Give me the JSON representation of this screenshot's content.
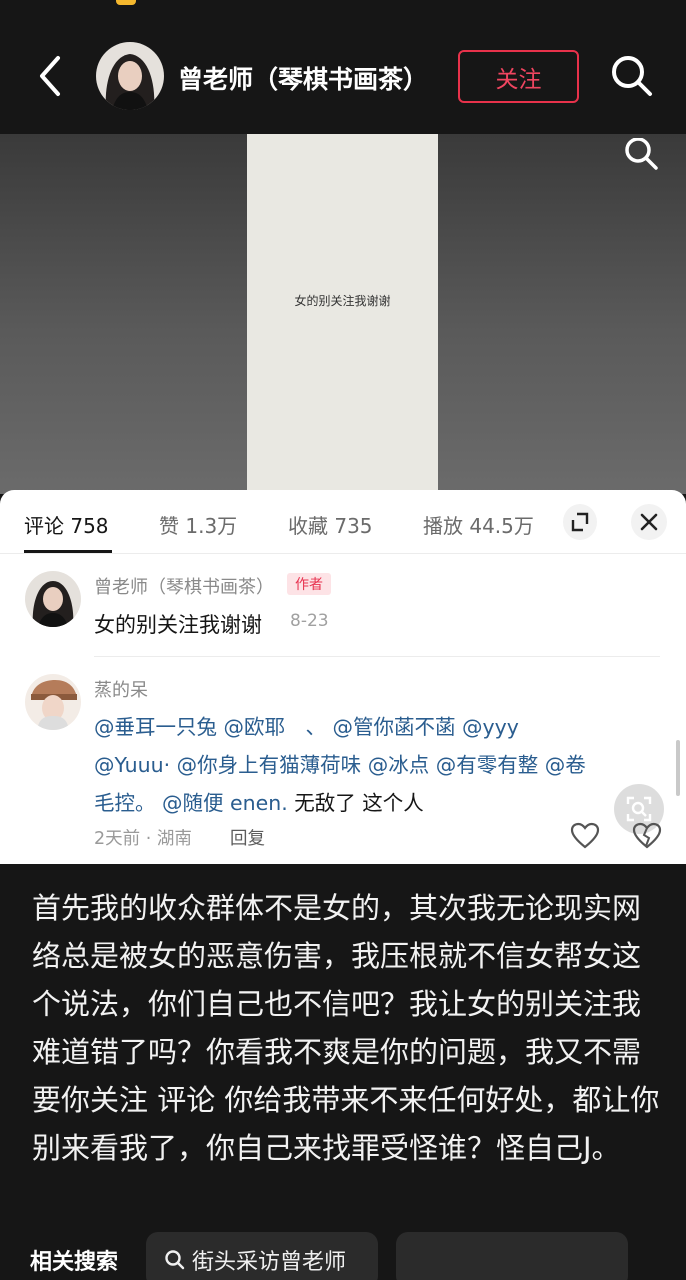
{
  "header": {
    "title": "曾老师（琴棋书画茶）",
    "follow_label": "关注"
  },
  "video": {
    "overlay_text": "女的别关注我谢谢"
  },
  "comments_panel": {
    "tabs": [
      {
        "label": "评论 758"
      },
      {
        "label": "赞 1.3万"
      },
      {
        "label": "收藏 735"
      },
      {
        "label": "播放 44.5万"
      }
    ],
    "author_comment": {
      "username": "曾老师（琴棋书画茶）",
      "badge": "作者",
      "text": "女的别关注我谢谢",
      "date": "8-23"
    },
    "reply_comment": {
      "username": "蒸的呆",
      "line1": "@垂耳一只兔 @欧耶　、 @管你菡不菡 @yyy",
      "line2": "@Yuuu· @你身上有猫薄荷味 @冰点 @有零有整 @卷",
      "line3_mentions": "毛控。 @随便 enen.",
      "line3_text": " 无敌了 这个人",
      "meta": "2天前 · 湖南",
      "reply_label": "回复"
    }
  },
  "caption": {
    "text": "首先我的收众群体不是女的，其次我无论现实网络总是被女的恶意伤害，我压根就不信女帮女这个说法，你们自己也不信吧？我让女的别关注我难道错了吗？你看我不爽是你的问题，我又不需要你关注 评论 你给我带来不来任何好处，都让你别来看我了，你自己来找罪受怪谁？怪自己J。"
  },
  "related": {
    "label": "相关搜索",
    "chip_text": "街头采访曾老师"
  },
  "colors": {
    "accent": "#e8324b",
    "background_dark": "#161616",
    "mention_blue": "#2a5d8f"
  },
  "icons": [
    "back-arrow-icon",
    "search-icon",
    "expand-icon",
    "close-icon",
    "heart-icon",
    "broken-heart-icon",
    "lens-search-icon"
  ]
}
